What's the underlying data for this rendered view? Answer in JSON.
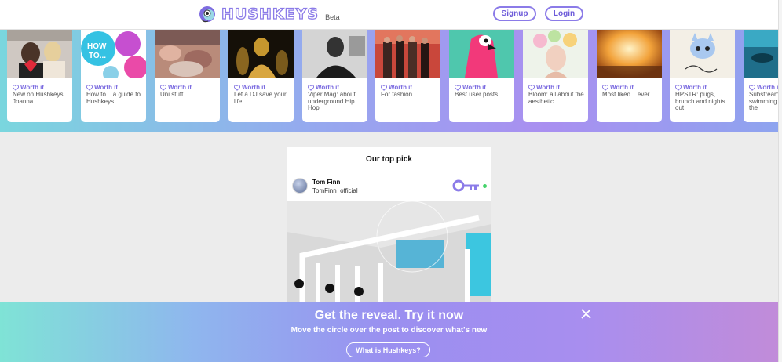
{
  "header": {
    "logo_text": "HUSHKEYS",
    "beta_label": "Beta",
    "signup_label": "Signup",
    "login_label": "Login",
    "logo_icon": "chameleon-logo-icon",
    "accent_color": "#8b7be8"
  },
  "carousel": {
    "worth_label": "Worth it",
    "heart_icon": "heart-outline-icon",
    "cards": [
      {
        "caption": "New on Hushkeys: Joanna",
        "image": "couple-heart-photo"
      },
      {
        "caption": "How to... a guide to Hushkeys",
        "image": "how-to-stickers-graphic"
      },
      {
        "caption": "Uni stuff",
        "image": "party-crowd-photo"
      },
      {
        "caption": "Let a DJ save your life",
        "image": "gold-performer-photo"
      },
      {
        "caption": "Viper Mag: about underground Hip Hop",
        "image": "bw-portrait-photo"
      },
      {
        "caption": "For fashion...",
        "image": "models-group-photo"
      },
      {
        "caption": "Best user posts",
        "image": "pink-parrot-art"
      },
      {
        "caption": "Bloom: all about the aesthetic",
        "image": "flower-crown-photo"
      },
      {
        "caption": "Most liked... ever",
        "image": "concert-lights-photo"
      },
      {
        "caption": "HPSTR: pugs, brunch and nights out",
        "image": "cat-sticker-art"
      },
      {
        "caption": "Substream: swimming against the",
        "image": "underwater-photo"
      }
    ]
  },
  "feed": {
    "title": "Our top pick",
    "post": {
      "user_name": "Tom Finn",
      "user_handle": "TomFinn_official",
      "key_icon": "purple-key-icon",
      "status_color": "#45d36b"
    }
  },
  "banner": {
    "title": "Get the reveal. Try it now",
    "subtitle": "Move the circle over the post to discover what's new",
    "button_label": "What is Hushkeys?",
    "close_icon": "close-icon"
  }
}
